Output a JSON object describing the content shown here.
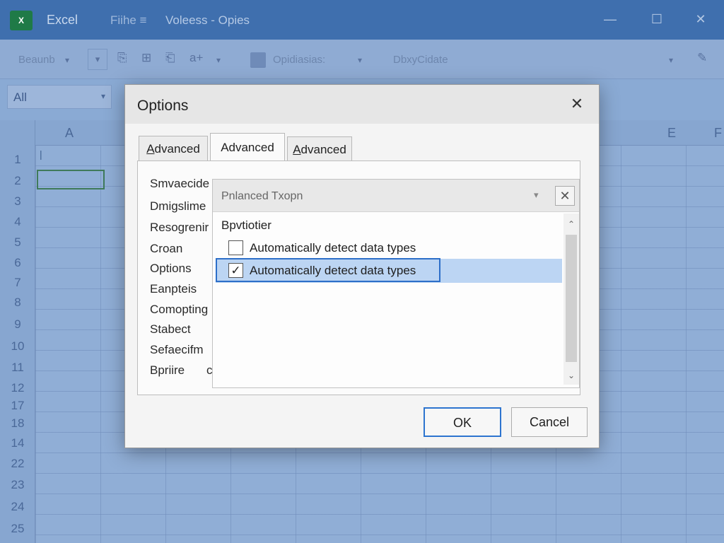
{
  "app": {
    "logo_text": "X",
    "name": "Excel",
    "file_menu": "Fiihe ≡",
    "window_title": "Voleess - Opies"
  },
  "window_controls": {
    "minimize": "—",
    "maximize": "☐",
    "close": "✕"
  },
  "ribbon": {
    "left_label": "Beaunb",
    "left_dropdown": "▾",
    "dropdown_arrow": "▾",
    "tools": [
      "⎘",
      "⊞",
      "⎗",
      "a+"
    ],
    "tool_dropdown": "▾",
    "options_label": "Opidiasias:",
    "options_dropdown": "▾",
    "right_label": "DbxyCidate",
    "right_dropdown": "▾",
    "pen_icon": "✎"
  },
  "namebox": {
    "value": "All",
    "arrow": "▾"
  },
  "columns": [
    "A",
    "E",
    "F"
  ],
  "rows": [
    "1",
    "2",
    "3",
    "4",
    "5",
    "6",
    "7",
    "8",
    "9",
    "10",
    "11",
    "12",
    "17",
    "18",
    "14",
    "22",
    "23",
    "24",
    "25"
  ],
  "dialog": {
    "title": "Options",
    "close": "✕",
    "tabs": [
      {
        "label": "Advanced",
        "underline": "A",
        "rest": "dvanced"
      },
      {
        "label": "Advanced"
      },
      {
        "label": "Advanced",
        "underline": "A",
        "rest": "dvanced"
      }
    ],
    "categories": [
      "Smvaecide",
      "Dmigslime",
      "Resogrenir",
      "Croan",
      "Options",
      "Eanpteis",
      "Comopting",
      "Stabect",
      "Sefaecifm",
      "Bpriire"
    ],
    "category_extra": "c",
    "subpanel": {
      "title": "Pnlanced Txopn",
      "dropdown": "▾",
      "close": "✕",
      "group_label": "Bpvtiotier",
      "options": [
        {
          "label": "Automatically detect data types",
          "checked": false,
          "mark": ""
        },
        {
          "label": "Automatically detect data types",
          "checked": true,
          "mark": "✓"
        }
      ],
      "scroll_up": "⌃",
      "scroll_down": "⌄"
    },
    "ok_label": "OK",
    "cancel_label": "Cancel"
  }
}
